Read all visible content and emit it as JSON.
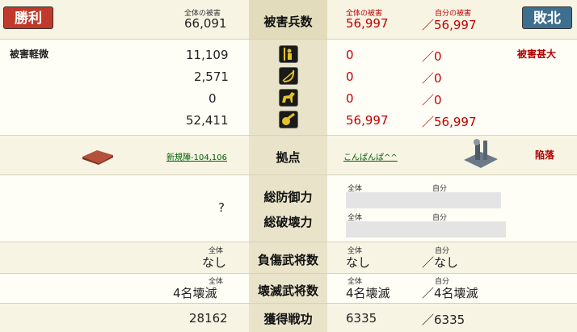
{
  "header": {
    "victory_label": "勝利",
    "defeat_label": "敗北",
    "total_damage_caption": "全体の被害",
    "self_damage_caption": "自分の被害",
    "left_total": "66,091",
    "center_title": "被害兵数",
    "right_total": "56,997",
    "right_self": "／56,997"
  },
  "left_status": "被害軽微",
  "right_status": "被害甚大",
  "units": [
    {
      "icon": "spearman-icon",
      "left": "11,109",
      "right_total": "0",
      "right_self": "／0"
    },
    {
      "icon": "archer-icon",
      "left": "2,571",
      "right_total": "0",
      "right_self": "／0"
    },
    {
      "icon": "cavalry-icon",
      "left": "0",
      "right_total": "0",
      "right_self": "／0"
    },
    {
      "icon": "siege-icon",
      "left": "52,411",
      "right_total": "56,997",
      "right_self": "／56,997"
    }
  ],
  "base": {
    "label": "拠点",
    "left_link": "新規陣-104,106",
    "right_link": "こんぱんぱ^^",
    "right_status": "陥落"
  },
  "defense": {
    "label1": "総防御力",
    "label2": "総破壊力",
    "left_value": "?",
    "caption_total": "全体",
    "caption_self": "自分"
  },
  "injured": {
    "label": "負傷武将数",
    "caption_total": "全体",
    "caption_self": "自分",
    "left": "なし",
    "right_total": "なし",
    "right_self": "／なし"
  },
  "destroyed": {
    "label": "壊滅武将数",
    "caption_total": "全体",
    "caption_self": "自分",
    "left": "4名壊滅",
    "right_total": "4名壊滅",
    "right_self": "／4名壊滅"
  },
  "merit": {
    "label": "獲得戦功",
    "left": "28162",
    "right_total": "6335",
    "right_self": "／6335"
  },
  "colors": {
    "victory": "#c0392b",
    "defeat": "#3f6f8f",
    "damage_red": "#c00000"
  }
}
